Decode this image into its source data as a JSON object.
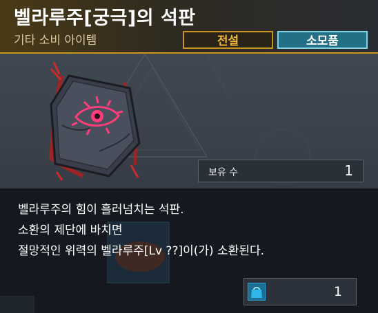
{
  "item": {
    "name": "벨라루주[궁극]의 석판",
    "category": "기타 소비 아이템",
    "tags": {
      "grade": "전설",
      "type": "소모품"
    }
  },
  "owned": {
    "label": "보유 수",
    "count": "1"
  },
  "description": {
    "lines": [
      "벨라루주의 힘이 흘러넘치는 석판.",
      "소환의 제단에 바치면",
      "절망적인 위력의 벨라루주[Lv ??]이(가) 소환된다."
    ]
  },
  "price": {
    "icon": "shopping-bag-icon",
    "quantity": "1"
  },
  "colors": {
    "gold_accent": "#c9951e",
    "legend_text": "#f2b73a",
    "consumable_bg": "#226f86",
    "eye_glow": "#ff3d7a"
  }
}
